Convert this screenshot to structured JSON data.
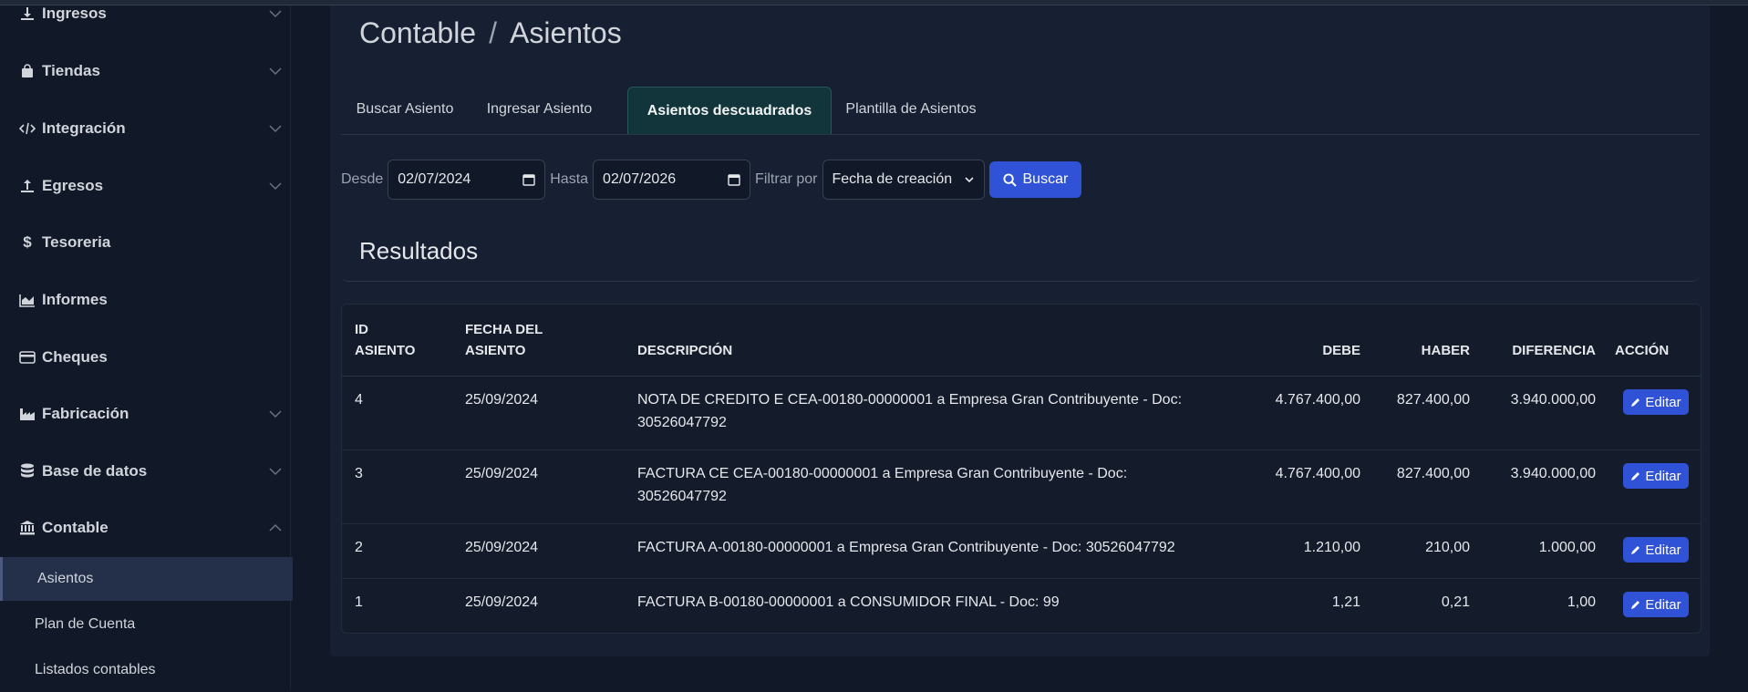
{
  "sidebar": {
    "items": [
      {
        "label": "Ingresos",
        "icon": "download-icon",
        "has_chevron": true
      },
      {
        "label": "Tiendas",
        "icon": "shopping-bag-icon",
        "has_chevron": true
      },
      {
        "label": "Integración",
        "icon": "code-icon",
        "has_chevron": true
      },
      {
        "label": "Egresos",
        "icon": "upload-icon",
        "has_chevron": true
      },
      {
        "label": "Tesoreria",
        "icon": "dollar-icon",
        "has_chevron": false
      },
      {
        "label": "Informes",
        "icon": "area-chart-icon",
        "has_chevron": false
      },
      {
        "label": "Cheques",
        "icon": "credit-card-icon",
        "has_chevron": false
      },
      {
        "label": "Fabricación",
        "icon": "industry-icon",
        "has_chevron": true
      },
      {
        "label": "Base de datos",
        "icon": "database-icon",
        "has_chevron": true
      },
      {
        "label": "Contable",
        "icon": "bank-icon",
        "has_chevron": true
      }
    ],
    "subitems": [
      {
        "label": "Asientos",
        "active": true
      },
      {
        "label": "Plan de Cuenta",
        "active": false
      },
      {
        "label": "Listados contables",
        "active": false
      }
    ]
  },
  "breadcrumb": {
    "parent": "Contable",
    "separator": "/",
    "current": "Asientos"
  },
  "tabs": [
    {
      "label": "Buscar Asiento",
      "active": false
    },
    {
      "label": "Ingresar Asiento",
      "active": false
    },
    {
      "label": "Asientos descuadrados",
      "active": true
    },
    {
      "label": "Plantilla de Asientos",
      "active": false
    }
  ],
  "filters": {
    "desde_label": "Desde",
    "desde_value": "02/07/2024",
    "hasta_label": "Hasta",
    "hasta_value": "02/07/2026",
    "filtrar_label": "Filtrar por",
    "filtrar_value": "Fecha de creación",
    "search_button": "Buscar"
  },
  "results_title": "Resultados",
  "table": {
    "headers": {
      "id_line1": "ID",
      "id_line2": "ASIENTO",
      "fecha_line1": "FECHA DEL",
      "fecha_line2": "ASIENTO",
      "descripcion": "DESCRIPCIÓN",
      "debe": "DEBE",
      "haber": "HABER",
      "diferencia": "DIFERENCIA",
      "accion": "ACCIÓN"
    },
    "rows": [
      {
        "id": "4",
        "fecha": "25/09/2024",
        "desc_line1": "NOTA DE CREDITO E CEA-00180-00000001 a Empresa Gran Contribuyente - Doc:",
        "desc_line2": "30526047792",
        "debe": "4.767.400,00",
        "haber": "827.400,00",
        "diferencia": "3.940.000,00",
        "action": "Editar"
      },
      {
        "id": "3",
        "fecha": "25/09/2024",
        "desc_line1": "FACTURA CE CEA-00180-00000001 a Empresa Gran Contribuyente - Doc:",
        "desc_line2": "30526047792",
        "debe": "4.767.400,00",
        "haber": "827.400,00",
        "diferencia": "3.940.000,00",
        "action": "Editar"
      },
      {
        "id": "2",
        "fecha": "25/09/2024",
        "desc_line1": "FACTURA A-00180-00000001 a Empresa Gran Contribuyente - Doc: 30526047792",
        "desc_line2": "",
        "debe": "1.210,00",
        "haber": "210,00",
        "diferencia": "1.000,00",
        "action": "Editar"
      },
      {
        "id": "1",
        "fecha": "25/09/2024",
        "desc_line1": "FACTURA B-00180-00000001 a CONSUMIDOR FINAL - Doc: 99",
        "desc_line2": "",
        "debe": "1,21",
        "haber": "0,21",
        "diferencia": "1,00",
        "action": "Editar"
      }
    ]
  },
  "colors": {
    "accent": "#2f52d6",
    "active_tab": "#11353a",
    "background": "#111827",
    "card": "#172032"
  }
}
